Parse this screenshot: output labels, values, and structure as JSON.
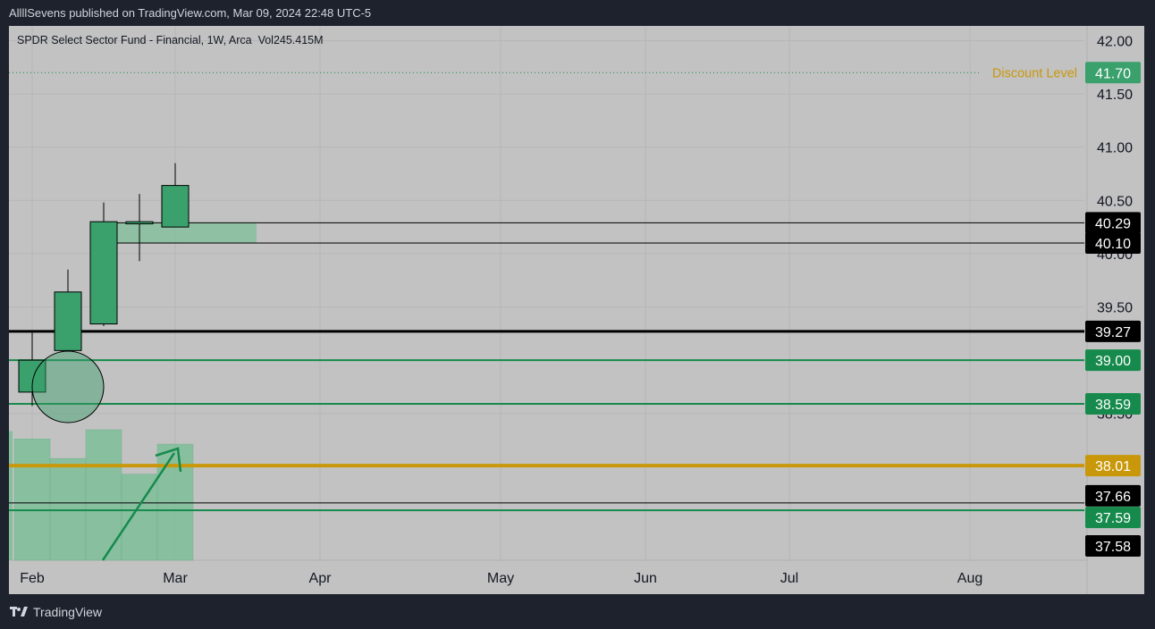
{
  "header": {
    "published_text": "AllllSevens published on TradingView.com, Mar 09, 2024 22:48 UTC-5"
  },
  "footer": {
    "brand": "TradingView"
  },
  "colors": {
    "panel_bg": "#c2c2c2",
    "candle_up": "#3aa06c",
    "green_line": "#168a4c",
    "gold_line": "#c9980a",
    "black_line": "#000000",
    "volume": "#7ebf9a"
  },
  "chart_data": {
    "type": "candlestick",
    "title": "SPDR Select Sector Fund - Financial, 1W, Arca",
    "volume_label": "Vol245.415M",
    "ylim": [
      37.5,
      42.2
    ],
    "y_ticks": [
      "42.00",
      "41.50",
      "41.00",
      "40.50",
      "40.00",
      "39.50",
      "38.50"
    ],
    "x_ticks": [
      "Feb",
      "Mar",
      "Apr",
      "May",
      "Jun",
      "Jul",
      "Aug"
    ],
    "candles": [
      {
        "date": "2024-01-29",
        "open": 38.7,
        "high": 39.26,
        "low": 38.57,
        "close": 39.0
      },
      {
        "date": "2024-02-05",
        "open": 39.09,
        "high": 39.85,
        "low": 39.09,
        "close": 39.64
      },
      {
        "date": "2024-02-12",
        "open": 39.34,
        "high": 40.48,
        "low": 39.32,
        "close": 40.3
      },
      {
        "date": "2024-02-19",
        "open": 40.28,
        "high": 40.56,
        "low": 39.93,
        "close": 40.3
      },
      {
        "date": "2024-02-26",
        "open": 40.25,
        "high": 40.85,
        "low": 40.25,
        "close": 40.64
      }
    ],
    "volume_relative": [
      0.93,
      0.78,
      1.0,
      0.66,
      0.89
    ],
    "price_levels": [
      {
        "price": 41.7,
        "label": "41.70",
        "style": "dotted-green",
        "annotation": "Discount Level"
      },
      {
        "price": 40.29,
        "label": "40.29",
        "style": "black"
      },
      {
        "price": 40.1,
        "label": "40.10",
        "style": "black"
      },
      {
        "price": 39.27,
        "label": "39.27",
        "style": "black-thick"
      },
      {
        "price": 39.0,
        "label": "39.00",
        "style": "green"
      },
      {
        "price": 38.59,
        "label": "38.59",
        "style": "green"
      },
      {
        "price": 38.01,
        "label": "38.01",
        "style": "gold"
      },
      {
        "price": 37.66,
        "label": "37.66",
        "style": "black"
      },
      {
        "price": 37.59,
        "label": "37.59",
        "style": "green"
      }
    ],
    "extra_price_label": {
      "label": "37.58",
      "style": "black"
    },
    "gap_zone": {
      "from": 40.1,
      "to": 40.29
    }
  }
}
